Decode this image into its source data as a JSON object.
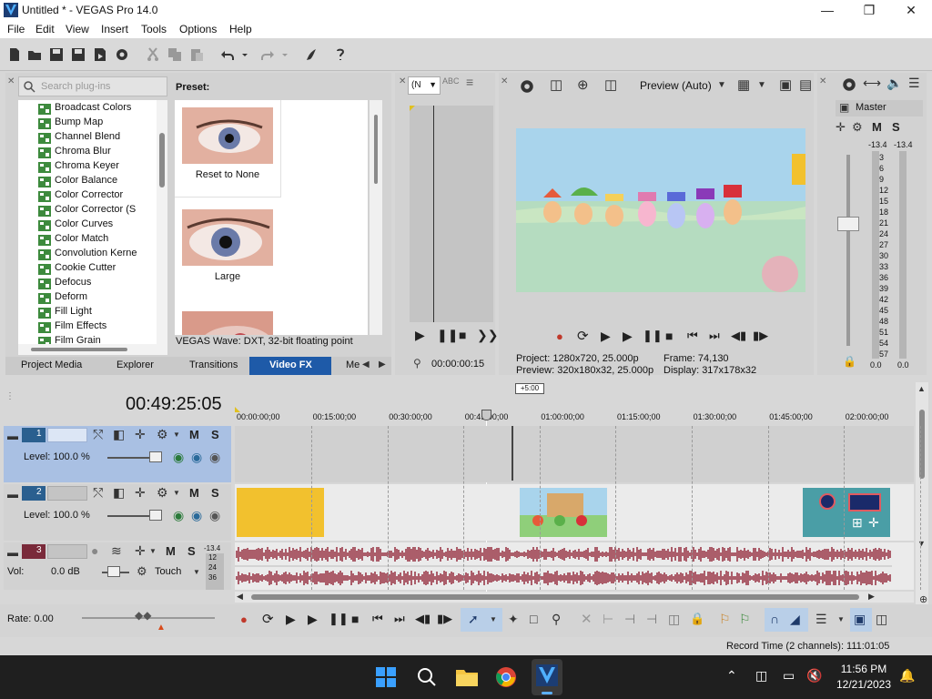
{
  "window": {
    "title": "Untitled * - VEGAS Pro 14.0",
    "controls": [
      "minimize-icon",
      "restore-icon",
      "close-icon"
    ]
  },
  "menubar": [
    "File",
    "Edit",
    "View",
    "Insert",
    "Tools",
    "Options",
    "Help"
  ],
  "plugins": {
    "search_placeholder": "Search plug-ins",
    "items": [
      "Broadcast Colors",
      "Bump Map",
      "Channel Blend",
      "Chroma Blur",
      "Chroma Keyer",
      "Color Balance",
      "Color Corrector",
      "Color Corrector (S",
      "Color Curves",
      "Color Match",
      "Convolution Kerne",
      "Cookie Cutter",
      "Defocus",
      "Deform",
      "Fill Light",
      "Film Effects",
      "Film Grain"
    ],
    "preset_label": "Preset:",
    "presets": [
      "Reset to None",
      "Large"
    ],
    "status": "VEGAS Wave: DXT, 32-bit floating point"
  },
  "tabs": [
    "Project Media",
    "Explorer",
    "Transitions",
    "Video FX",
    "Me"
  ],
  "active_tab": "Video FX",
  "trimmer": {
    "dropdown_value": "(N",
    "timecode": "00:00:00:15"
  },
  "preview": {
    "quality": "Preview (Auto)",
    "project_label": "Project:",
    "project_value": "1280x720, 25.000p",
    "preview_label": "Preview:",
    "preview_value": "320x180x32, 25.000p",
    "frame_label": "Frame:",
    "frame_value": "74,130",
    "display_label": "Display:",
    "display_value": "317x178x32"
  },
  "master": {
    "label": "Master",
    "m": "M",
    "s": "S",
    "left_level": "-13.4",
    "right_level": "-13.4",
    "scale": [
      "3",
      "6",
      "9",
      "12",
      "15",
      "18",
      "21",
      "24",
      "27",
      "30",
      "33",
      "36",
      "39",
      "42",
      "45",
      "48",
      "51",
      "54",
      "57"
    ],
    "left_bottom": "0.0",
    "right_bottom": "0.0"
  },
  "timeline": {
    "time": "00:49:25:05",
    "marker": "+5:00",
    "ruler": [
      "00:00:00;00",
      "00:15:00;00",
      "00:30:00;00",
      "00:45:00;00",
      "01:00:00;00",
      "01:15:00;00",
      "01:30:00;00",
      "01:45:00;00",
      "02:00:00;00"
    ],
    "tracks": [
      {
        "number": "1",
        "level": "Level: 100.0 %",
        "m": "M",
        "s": "S"
      },
      {
        "number": "2",
        "level": "Level: 100.0 %",
        "m": "M",
        "s": "S"
      },
      {
        "number": "3",
        "vol_label": "Vol:",
        "vol_value": "0.0 dB",
        "touch": "Touch",
        "m": "M",
        "s": "S",
        "meter": "-13.4",
        "meter_scale": [
          "12",
          "24",
          "36"
        ]
      }
    ]
  },
  "rate": "Rate: 0.00",
  "record_time": "Record Time (2 channels): 111:01:05",
  "taskbar": {
    "time": "11:56 PM",
    "date": "12/21/2023"
  },
  "colors": {
    "accent": "#1e5aa8",
    "track_selected": "#a9c0e3",
    "audio_wave": "#9b3a4a",
    "yellow_clip": "#f2c12e",
    "teal_clip": "#4a9ea6"
  }
}
